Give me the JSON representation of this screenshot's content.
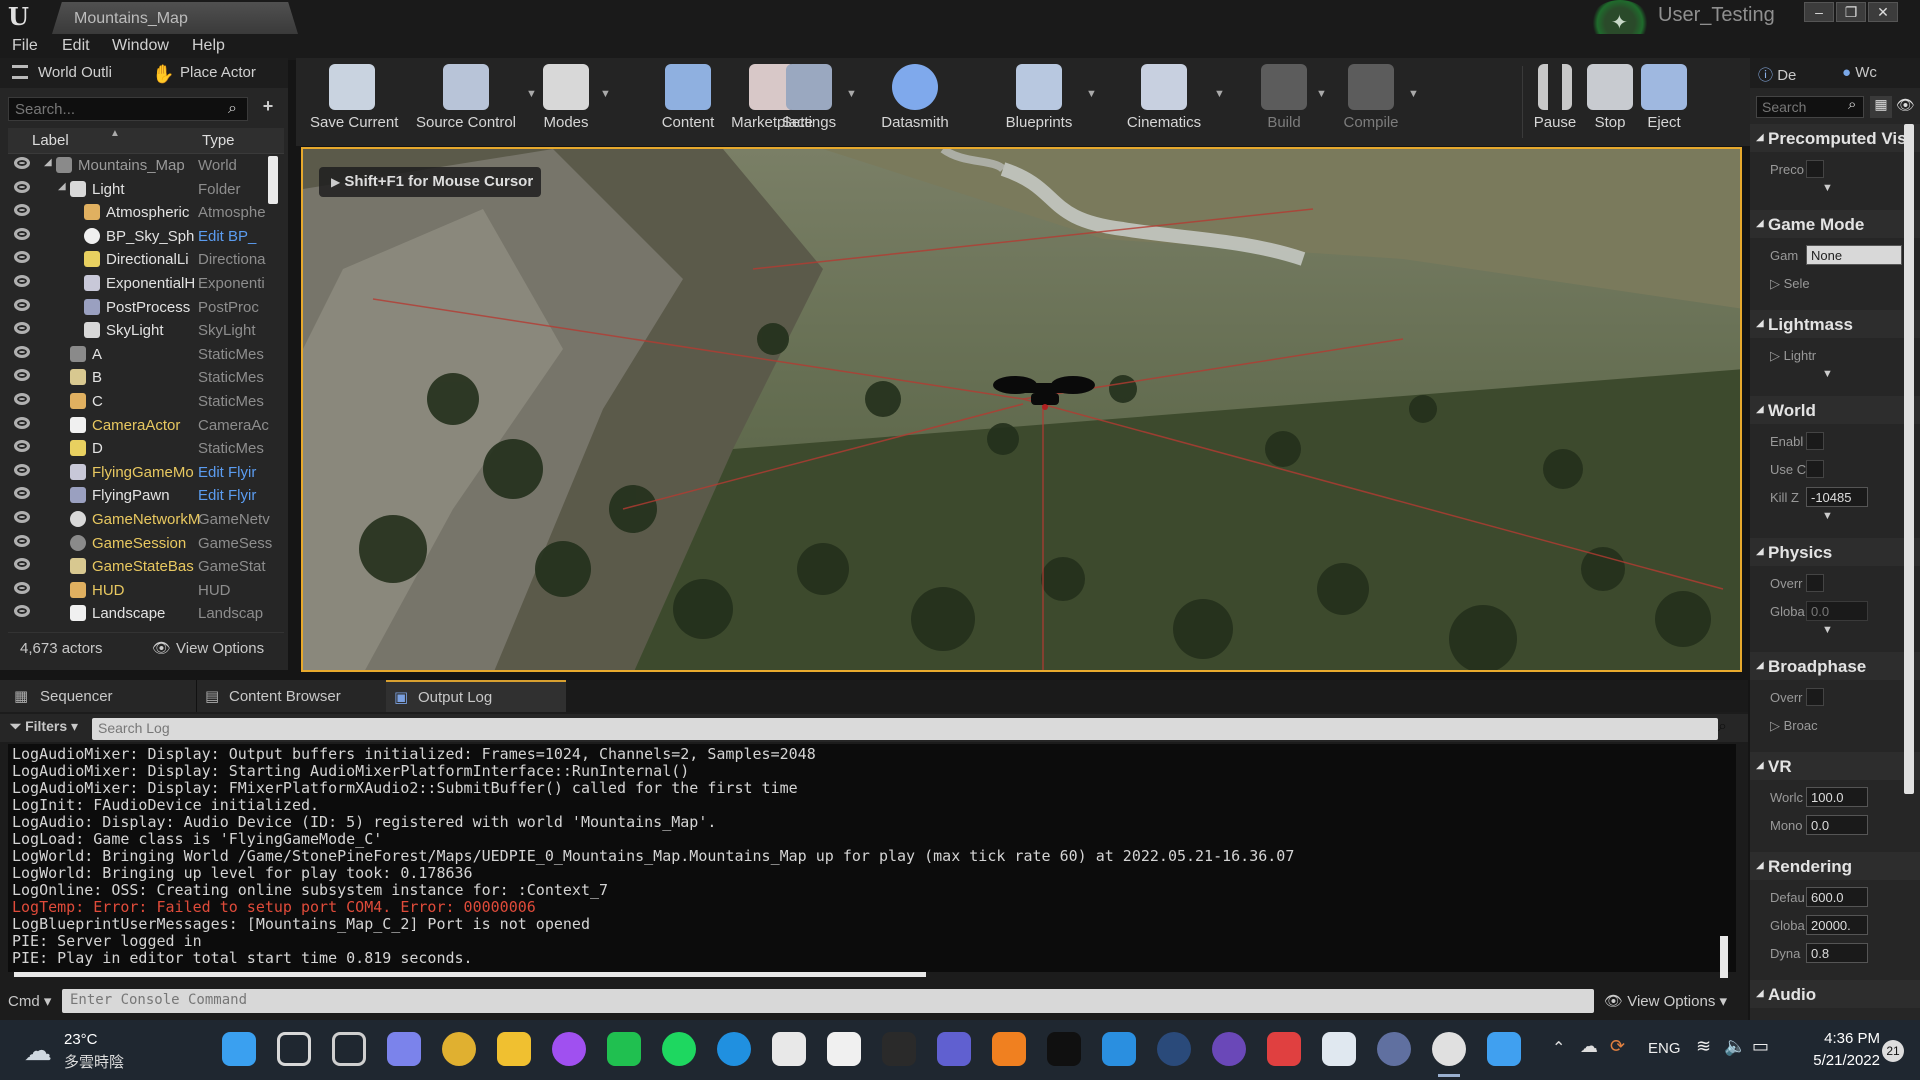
{
  "window": {
    "title": "Mountains_Map",
    "user": "User_Testing",
    "minimize": "–",
    "maximize": "❐",
    "close": "✕"
  },
  "menu": [
    "File",
    "Edit",
    "Window",
    "Help"
  ],
  "outliner": {
    "tab_world": "World Outli",
    "tab_place": "Place Actor",
    "search_placeholder": "Search...",
    "col_label": "Label",
    "col_type": "Type",
    "rows": [
      {
        "label": "Mountains_Map",
        "type": "World",
        "indent": 0,
        "link": false,
        "color": "#9a9a9a"
      },
      {
        "label": "Light",
        "type": "Folder",
        "indent": 1,
        "link": false,
        "color": "#e2e2e2"
      },
      {
        "label": "Atmospheric",
        "type": "Atmosphe",
        "indent": 2,
        "link": false,
        "color": "#e2e2e2"
      },
      {
        "label": "BP_Sky_Sph",
        "type": "Edit BP_",
        "indent": 2,
        "link": true,
        "color": "#e2e2e2"
      },
      {
        "label": "DirectionalLi",
        "type": "Directiona",
        "indent": 2,
        "link": false,
        "color": "#e2e2e2"
      },
      {
        "label": "ExponentialH",
        "type": "Exponenti",
        "indent": 2,
        "link": false,
        "color": "#e2e2e2"
      },
      {
        "label": "PostProcess",
        "type": "PostProc",
        "indent": 2,
        "link": false,
        "color": "#e2e2e2"
      },
      {
        "label": "SkyLight",
        "type": "SkyLight",
        "indent": 2,
        "link": false,
        "color": "#e2e2e2"
      },
      {
        "label": "A",
        "type": "StaticMes",
        "indent": 1,
        "link": false,
        "color": "#e2e2e2"
      },
      {
        "label": "B",
        "type": "StaticMes",
        "indent": 1,
        "link": false,
        "color": "#e2e2e2"
      },
      {
        "label": "C",
        "type": "StaticMes",
        "indent": 1,
        "link": false,
        "color": "#e2e2e2"
      },
      {
        "label": "CameraActor",
        "type": "CameraAc",
        "indent": 1,
        "link": false,
        "color": "#e8c860"
      },
      {
        "label": "D",
        "type": "StaticMes",
        "indent": 1,
        "link": false,
        "color": "#e2e2e2"
      },
      {
        "label": "FlyingGameMo",
        "type": "Edit Flyir",
        "indent": 1,
        "link": true,
        "color": "#e8c860"
      },
      {
        "label": "FlyingPawn",
        "type": "Edit Flyir",
        "indent": 1,
        "link": true,
        "color": "#e2e2e2"
      },
      {
        "label": "GameNetworkM",
        "type": "GameNetv",
        "indent": 1,
        "link": false,
        "color": "#e8c860"
      },
      {
        "label": "GameSession",
        "type": "GameSess",
        "indent": 1,
        "link": false,
        "color": "#e8c860"
      },
      {
        "label": "GameStateBas",
        "type": "GameStat",
        "indent": 1,
        "link": false,
        "color": "#e8c860"
      },
      {
        "label": "HUD",
        "type": "HUD",
        "indent": 1,
        "link": false,
        "color": "#e8c860"
      },
      {
        "label": "Landscape",
        "type": "Landscap",
        "indent": 1,
        "link": false,
        "color": "#e2e2e2"
      }
    ],
    "actor_count": "4,673 actors",
    "view_options": "View Options"
  },
  "toolbar": [
    {
      "label": "Save Current",
      "icon": "save-icon",
      "disabled": false,
      "color": "#c9d3e0"
    },
    {
      "label": "Source Control",
      "icon": "source-control-icon",
      "disabled": false,
      "color": "#b8c4d8"
    },
    {
      "label": "Modes",
      "icon": "modes-icon",
      "disabled": false,
      "color": "#d8d8d8"
    },
    {
      "label": "Content",
      "icon": "content-icon",
      "disabled": false,
      "color": "#8fb0e0"
    },
    {
      "label": "Marketplace",
      "icon": "marketplace-icon",
      "disabled": false,
      "color": "#d8c8c8"
    },
    {
      "label": "Settings",
      "icon": "settings-icon",
      "disabled": false,
      "color": "#9aa8c0"
    },
    {
      "label": "Datasmith",
      "icon": "datasmith-icon",
      "disabled": false,
      "color": "#7fa9ec"
    },
    {
      "label": "Blueprints",
      "icon": "blueprints-icon",
      "disabled": false,
      "color": "#b8c8e0"
    },
    {
      "label": "Cinematics",
      "icon": "cinematics-icon",
      "disabled": false,
      "color": "#c8d0e0"
    },
    {
      "label": "Build",
      "icon": "build-icon",
      "disabled": true,
      "color": "#5c5c5c"
    },
    {
      "label": "Compile",
      "icon": "compile-icon",
      "disabled": true,
      "color": "#5c5c5c"
    },
    {
      "label": "Pause",
      "icon": "pause-icon",
      "disabled": false,
      "color": "#c8c8c8"
    },
    {
      "label": "Stop",
      "icon": "stop-icon",
      "disabled": false,
      "color": "#c8cbd0"
    },
    {
      "label": "Eject",
      "icon": "eject-icon",
      "disabled": false,
      "color": "#9fb8e0"
    }
  ],
  "viewport": {
    "hint": "Shift+F1 for Mouse Cursor"
  },
  "bottom_tabs": [
    "Sequencer",
    "Content Browser",
    "Output Log"
  ],
  "log": {
    "filters": "Filters",
    "search_placeholder": "Search Log",
    "lines": [
      {
        "text": "LogAudioMixer: Display: Output buffers initialized: Frames=1024, Channels=2, Samples=2048",
        "error": false
      },
      {
        "text": "LogAudioMixer: Display: Starting AudioMixerPlatformInterface::RunInternal()",
        "error": false
      },
      {
        "text": "LogAudioMixer: Display: FMixerPlatformXAudio2::SubmitBuffer() called for the first time",
        "error": false
      },
      {
        "text": "LogInit: FAudioDevice initialized.",
        "error": false
      },
      {
        "text": "LogAudio: Display: Audio Device (ID: 5) registered with world 'Mountains_Map'.",
        "error": false
      },
      {
        "text": "LogLoad: Game class is 'FlyingGameMode_C'",
        "error": false
      },
      {
        "text": "LogWorld: Bringing World /Game/StonePineForest/Maps/UEDPIE_0_Mountains_Map.Mountains_Map up for play (max tick rate 60) at 2022.05.21-16.36.07",
        "error": false
      },
      {
        "text": "LogWorld: Bringing up level for play took: 0.178636",
        "error": false
      },
      {
        "text": "LogOnline: OSS: Creating online subsystem instance for: :Context_7",
        "error": false
      },
      {
        "text": "LogTemp: Error: Failed to setup port COM4. Error: 00000006",
        "error": true
      },
      {
        "text": "LogBlueprintUserMessages: [Mountains_Map_C_2] Port is not opened",
        "error": false
      },
      {
        "text": "PIE: Server logged in",
        "error": false
      },
      {
        "text": "PIE: Play in editor total start time 0.819 seconds.",
        "error": false
      }
    ],
    "cmd": "Cmd",
    "console_placeholder": "Enter Console Command",
    "view_options": "View Options"
  },
  "details": {
    "tab1": "De",
    "tab2": "Wc",
    "search_placeholder": "Search",
    "sections": [
      {
        "title": "Precomputed Vis",
        "props": [
          {
            "label": "Preco",
            "kind": "check"
          }
        ],
        "more": true
      },
      {
        "title": "Game Mode",
        "props": [
          {
            "label": "Gam",
            "kind": "select",
            "value": "None"
          },
          {
            "label": "Sele",
            "kind": "expand"
          }
        ],
        "more": false
      },
      {
        "title": "Lightmass",
        "props": [
          {
            "label": "Lightr",
            "kind": "expand"
          }
        ],
        "more": true
      },
      {
        "title": "World",
        "props": [
          {
            "label": "Enabl",
            "kind": "check"
          },
          {
            "label": "Use C",
            "kind": "check"
          },
          {
            "label": "Kill Z",
            "kind": "value",
            "value": "-10485"
          }
        ],
        "more": true
      },
      {
        "title": "Physics",
        "props": [
          {
            "label": "Overr",
            "kind": "check"
          },
          {
            "label": "Globa",
            "kind": "value",
            "value": "0.0",
            "dim": true
          }
        ],
        "more": true
      },
      {
        "title": "Broadphase",
        "props": [
          {
            "label": "Overr",
            "kind": "check"
          },
          {
            "label": "Broac",
            "kind": "expand"
          }
        ],
        "more": false
      },
      {
        "title": "VR",
        "props": [
          {
            "label": "Worlc",
            "kind": "value",
            "value": "100.0"
          },
          {
            "label": "Mono",
            "kind": "value",
            "value": "0.0"
          }
        ],
        "more": false
      },
      {
        "title": "Rendering",
        "props": [
          {
            "label": "Defau",
            "kind": "value",
            "value": "600.0"
          },
          {
            "label": "Globa",
            "kind": "value",
            "value": "20000."
          },
          {
            "label": "Dyna",
            "kind": "value",
            "value": "0.8"
          }
        ],
        "more": false
      },
      {
        "title": "Audio",
        "props": [],
        "more": false
      }
    ]
  },
  "taskbar": {
    "weather": "23°C",
    "weather_desc": "多雲時陰",
    "lang": "ENG",
    "time": "4:36 PM",
    "date": "5/21/2022",
    "notifications": "21",
    "apps": [
      {
        "icon": "windows-start-icon",
        "color": "#3aa0f0"
      },
      {
        "icon": "search-icon",
        "color": "#d8d8d8"
      },
      {
        "icon": "task-view-icon",
        "color": "#cfcfcf"
      },
      {
        "icon": "teams-chat-icon",
        "color": "#7b83eb"
      },
      {
        "icon": "chrome-icon",
        "color": "#e0b030"
      },
      {
        "icon": "file-explorer-icon",
        "color": "#f0c030"
      },
      {
        "icon": "messenger-icon",
        "color": "#a050f0"
      },
      {
        "icon": "line-icon",
        "color": "#20c050"
      },
      {
        "icon": "spotify-icon",
        "color": "#1ed760"
      },
      {
        "icon": "edge-icon",
        "color": "#2090e0"
      },
      {
        "icon": "inkscape-icon",
        "color": "#e8e8e8"
      },
      {
        "icon": "oculus-icon",
        "color": "#f0f0f0"
      },
      {
        "icon": "epic-games-icon",
        "color": "#2a2a2a"
      },
      {
        "icon": "discord-like-icon",
        "color": "#6060d0"
      },
      {
        "icon": "sublime-icon",
        "color": "#f08020"
      },
      {
        "icon": "terminal-icon",
        "color": "#101010"
      },
      {
        "icon": "vscode-icon",
        "color": "#2a8fe0"
      },
      {
        "icon": "steam-icon",
        "color": "#2a4a7a"
      },
      {
        "icon": "github-icon",
        "color": "#6a48b8"
      },
      {
        "icon": "git-icon",
        "color": "#e04040"
      },
      {
        "icon": "notepad-icon",
        "color": "#e0e8f0"
      },
      {
        "icon": "vr-icon",
        "color": "#6070a0"
      },
      {
        "icon": "unreal-engine-icon",
        "color": "#e0e0e0"
      },
      {
        "icon": "home-icon",
        "color": "#40a0f0"
      }
    ]
  }
}
